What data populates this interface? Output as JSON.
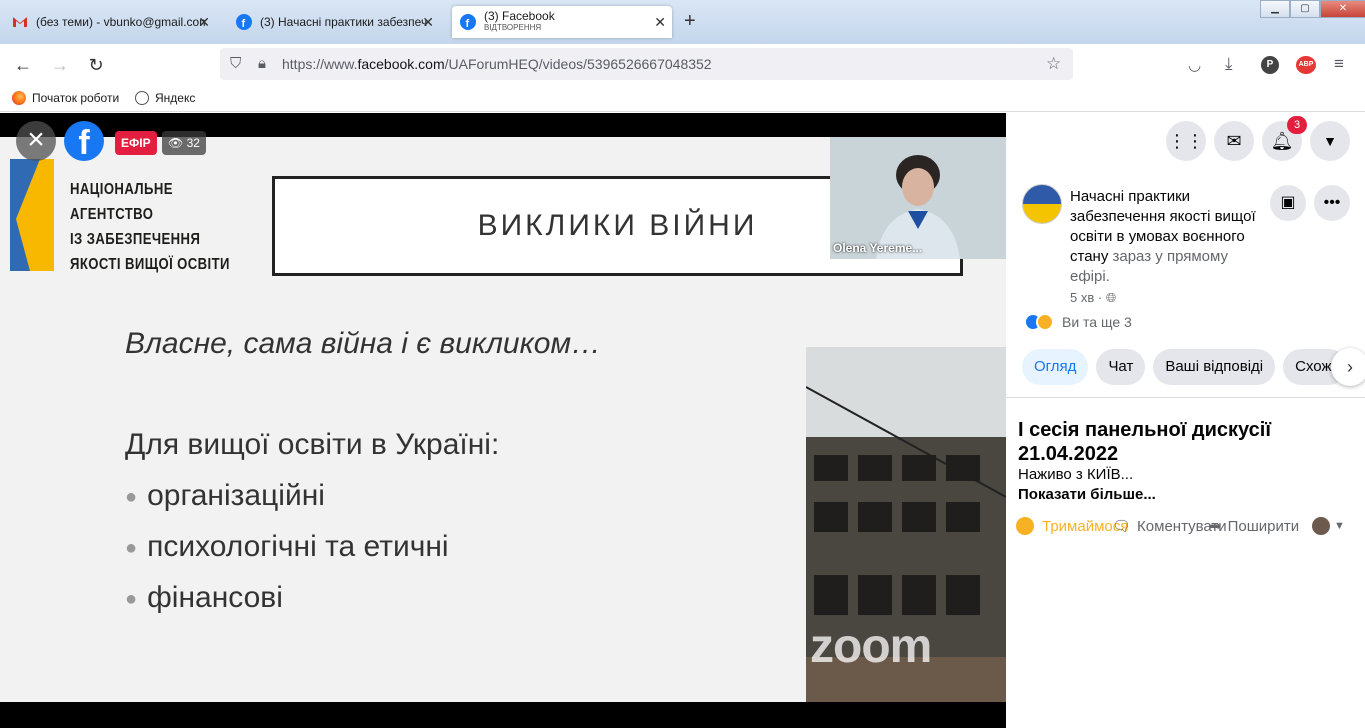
{
  "browser": {
    "tabs": [
      {
        "title": "(без теми) - vbunko@gmail.com",
        "icon": "gmail-icon"
      },
      {
        "title": "(3) Начасні практики забезпеч",
        "icon": "facebook-icon"
      },
      {
        "title": "(3) Facebook",
        "subtitle": "ВІДТВОРЕННЯ",
        "icon": "facebook-icon"
      }
    ],
    "url_prefix": "https://www.",
    "url_domain": "facebook.com",
    "url_path": "/UAForumHEQ/videos/5396526667048352",
    "bookmarks": [
      {
        "label": "Початок роботи",
        "icon": "firefox-icon"
      },
      {
        "label": "Яндекс",
        "icon": "globe-icon"
      }
    ]
  },
  "video": {
    "live_label": "ЕФІР",
    "viewers": "32",
    "webcam_name": "Olena Yereme...",
    "zoom_watermark": "zoom",
    "slide": {
      "org_lines": [
        "НАЦІОНАЛЬНЕ",
        "АГЕНТСТВО",
        "ІЗ ЗАБЕЗПЕЧЕННЯ",
        "ЯКОСТІ ВИЩОЇ ОСВІТИ"
      ],
      "title": "ВИКЛИКИ ВІЙНИ",
      "italic": "Власне, сама війна і є викликом…",
      "heading": "Для вищої освіти в Україні:",
      "bullets": [
        "організаційні",
        "психологічні та етичні",
        "фінансові"
      ]
    }
  },
  "panel": {
    "notifications_count": "3",
    "post_title": "Начасні практики забезпечення якості вищої освіти в умовах воєнного стану",
    "post_live_note": "зараз у прямому ефірі.",
    "post_time": "5 хв ·",
    "reactions_text": "Ви та ще 3",
    "tabs": [
      "Огляд",
      "Чат",
      "Ваші відповіді",
      "Схожі"
    ],
    "desc_title": "I сесія панельної дискусії 21.04.2022",
    "desc_line": "Наживо з КИЇВ...",
    "desc_more": "Показати більше...",
    "actions": {
      "care": "Тримаймося",
      "comment": "Коментувати",
      "share": "Поширити"
    }
  },
  "colors": {
    "facebook_blue": "#1877f2",
    "live_red": "#e41e3f",
    "care_yellow": "#f7b125"
  }
}
